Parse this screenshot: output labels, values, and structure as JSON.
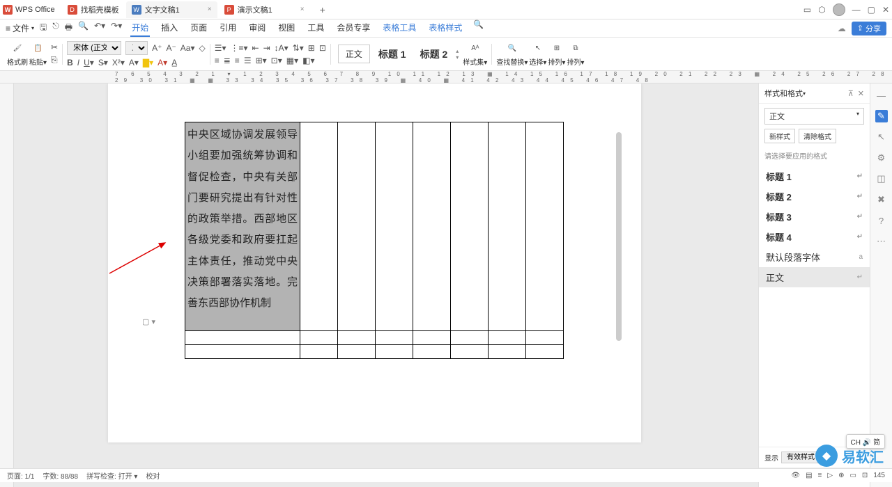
{
  "app": {
    "name": "WPS Office"
  },
  "tabs": [
    {
      "icon": "D",
      "iconClass": "orange",
      "title": "找稻壳模板"
    },
    {
      "icon": "W",
      "iconClass": "blue",
      "title": "文字文稿1",
      "active": true,
      "closable": true
    },
    {
      "icon": "P",
      "iconClass": "red",
      "title": "演示文稿1",
      "closable": true
    }
  ],
  "menu": {
    "file": "文件",
    "items": [
      "开始",
      "插入",
      "页面",
      "引用",
      "审阅",
      "视图",
      "工具",
      "会员专享"
    ],
    "context": [
      "表格工具",
      "表格样式"
    ],
    "share": "分享"
  },
  "toolbar": {
    "format_painter": "格式刷",
    "paste": "粘贴",
    "font_name": "宋体 (正文)",
    "font_size": "五号",
    "styles": {
      "normal": "正文",
      "h1": "标题 1",
      "h2": "标题 2"
    },
    "style_set": "样式集",
    "find_replace": "查找替换",
    "select": "选择",
    "arrange": "排列",
    "sort": "排列"
  },
  "document": {
    "cell_text": "中央区域协调发展领导小组要加强统筹协调和督促检查，中央有关部门要研究提出有针对性的政策举措。西部地区各级党委和政府要扛起主体责任，推动党中央决策部署落实落地。完善东西部协作机制"
  },
  "panel": {
    "title": "样式和格式",
    "current": "正文",
    "new_style": "新样式",
    "clear_format": "清除格式",
    "hint": "请选择要应用的格式",
    "styles": [
      "标题 1",
      "标题 2",
      "标题 3",
      "标题 4"
    ],
    "default_para": "默认段落字体",
    "body": "正文",
    "show": "显示",
    "show_value": "有效样式",
    "show_check": "显示"
  },
  "status": {
    "page": "页面: 1/1",
    "words": "字数: 88/88",
    "spell": "拼写检查: 打开",
    "proof": "校对",
    "zoom": "145"
  },
  "ime": "CH 🔊 简",
  "watermark": "易软汇"
}
